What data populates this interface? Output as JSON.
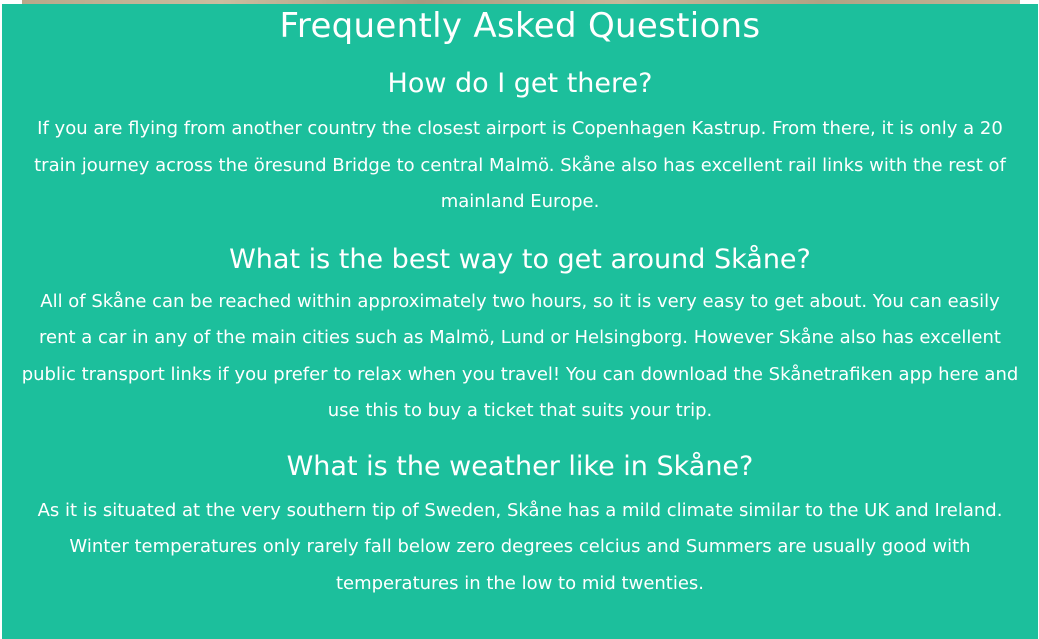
{
  "faq": {
    "title": "Frequently Asked Questions",
    "items": [
      {
        "question": "How do I get there?",
        "answer": "If you are flying from another country the closest airport is Copenhagen Kastrup. From there, it is only a 20 train journey across the öresund Bridge to central Malmö. Skåne also has excellent rail links with the rest of mainland Europe."
      },
      {
        "question": "What is the best way to get around Skåne?",
        "answer": "All of Skåne can be reached within approximately two hours, so it is very easy to get about. You can easily rent a car in any of the main cities such as Malmö, Lund or Helsingborg. However Skåne also has excellent public transport links if you prefer to relax when you travel! You can download the Skånetrafiken app here and use this to buy a ticket that suits your trip."
      },
      {
        "question": "What is the weather like in Skåne?",
        "answer": "As it is situated at the very southern tip of Sweden, Skåne has a mild climate similar to the UK and Ireland. Winter temperatures only rarely fall below zero degrees celcius and Summers are usually good with temperatures in the low to mid twenties."
      }
    ]
  },
  "colors": {
    "section_background": "#1cbf9c",
    "text": "#ffffff"
  }
}
